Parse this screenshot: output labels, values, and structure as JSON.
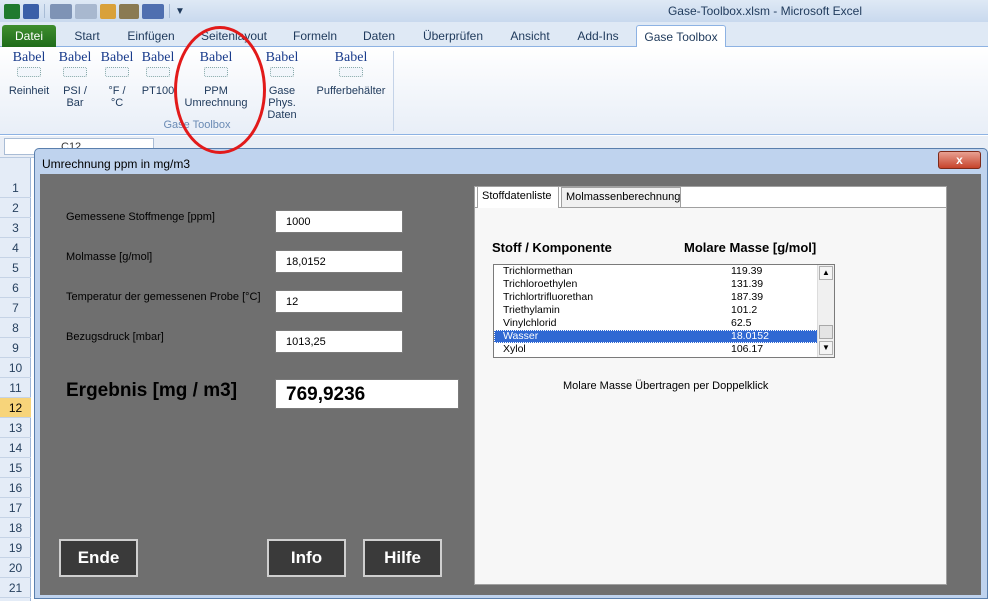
{
  "window": {
    "title": "Gase-Toolbox.xlsm  -  Microsoft Excel"
  },
  "qat": {
    "icons": [
      "excel-logo-icon",
      "save-icon",
      "undo-icon",
      "redo-icon",
      "chart-icon",
      "tool-icon",
      "edit-icon",
      "customize-icon"
    ]
  },
  "ribbon": {
    "tabs": [
      "Datei",
      "Start",
      "Einfügen",
      "Seitenlayout",
      "Formeln",
      "Daten",
      "Überprüfen",
      "Ansicht",
      "Add-Ins",
      "Gase Toolbox"
    ],
    "active_tab": "Gase Toolbox",
    "group_label": "Gase Toolbox",
    "buttons": [
      {
        "icon": "Babel",
        "label1": "Reinheit",
        "label2": ""
      },
      {
        "icon": "Babel",
        "label1": "PSI /",
        "label2": "Bar"
      },
      {
        "icon": "Babel",
        "label1": "°F /",
        "label2": "°C"
      },
      {
        "icon": "Babel",
        "label1": "PT100",
        "label2": ""
      },
      {
        "icon": "Babel",
        "label1": "PPM",
        "label2": "Umrechnung"
      },
      {
        "icon": "Babel",
        "label1": "Gase Phys.",
        "label2": "Daten"
      },
      {
        "icon": "Babel",
        "label1": "Pufferbehälter",
        "label2": ""
      }
    ]
  },
  "formula_bar": {
    "name_box": "C12"
  },
  "sheet": {
    "rows": [
      "1",
      "2",
      "3",
      "4",
      "5",
      "6",
      "7",
      "8",
      "9",
      "10",
      "11",
      "12",
      "13",
      "14",
      "15",
      "16",
      "17",
      "18",
      "19",
      "20",
      "21"
    ],
    "selected_row": "12"
  },
  "dialog": {
    "title": "Umrechnung ppm in mg/m3",
    "close_label": "x",
    "fields": [
      {
        "label": "Gemessene Stoffmenge [ppm]",
        "value": "1000"
      },
      {
        "label": "Molmasse [g/mol]",
        "value": "18,0152"
      },
      {
        "label": "Temperatur der gemessenen Probe [°C]",
        "value": "12"
      },
      {
        "label": "Bezugsdruck [mbar]",
        "value": "1013,25"
      }
    ],
    "result_label": "Ergebnis [mg / m3]",
    "result_value": "769,9236",
    "buttons": {
      "ende": "Ende",
      "info": "Info",
      "hilfe": "Hilfe"
    },
    "panel": {
      "tabs": [
        "Stoffdatenliste",
        "Molmassenberechnung"
      ],
      "active_tab": "Stoffdatenliste",
      "col_stoff": "Stoff / Komponente",
      "col_masse": "Molare Masse  [g/mol]",
      "items": [
        {
          "name": "Trichlormethan",
          "value": "119.39"
        },
        {
          "name": "Trichloroethylen",
          "value": "131.39"
        },
        {
          "name": "Trichlortrifluorethan",
          "value": "187.39"
        },
        {
          "name": "Triethylamin",
          "value": "101.2"
        },
        {
          "name": "Vinylchlorid",
          "value": "62.5"
        },
        {
          "name": "Wasser",
          "value": "18.0152"
        },
        {
          "name": "Xylol",
          "value": "106.17"
        }
      ],
      "selected_item": "Wasser",
      "hint": "Molare Masse Übertragen per Doppelklick"
    }
  }
}
